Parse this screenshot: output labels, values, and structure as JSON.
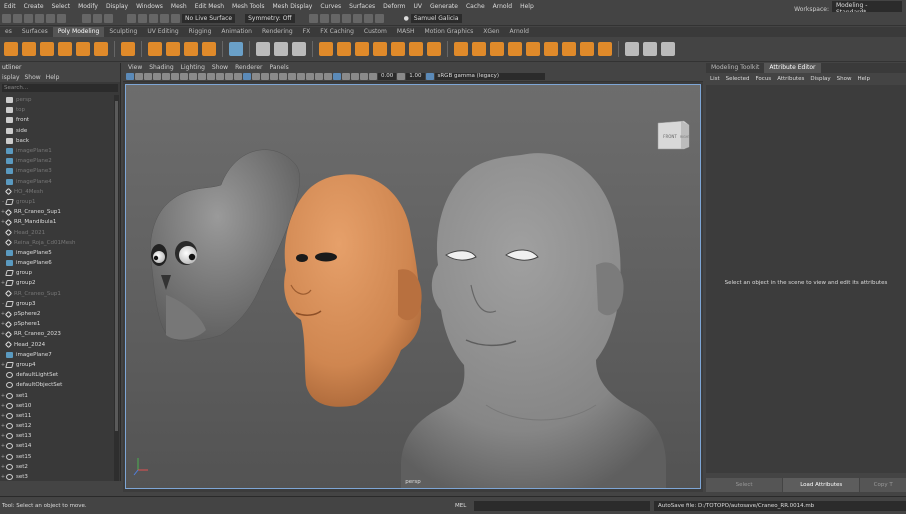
{
  "menubar": {
    "items": [
      "Edit",
      "Create",
      "Select",
      "Modify",
      "Display",
      "Windows",
      "Mesh",
      "Edit Mesh",
      "Mesh Tools",
      "Mesh Display",
      "Curves",
      "Surfaces",
      "Deform",
      "UV",
      "Generate",
      "Cache",
      "Arnold",
      "Help"
    ],
    "workspace_label": "Workspace:",
    "workspace_value": "Modeling - Standard*"
  },
  "statusline": {
    "live_surface": "No Live Surface",
    "symmetry": "Symmetry: Off",
    "user": "Samuel Galicia"
  },
  "shelf": {
    "tabs": [
      "es",
      "Surfaces",
      "Poly Modeling",
      "Sculpting",
      "UV Editing",
      "Rigging",
      "Animation",
      "Rendering",
      "FX",
      "FX Caching",
      "Custom",
      "MASH",
      "Motion Graphics",
      "XGen",
      "Arnold"
    ],
    "active_tab": "Poly Modeling"
  },
  "outliner": {
    "title": "utliner",
    "menu": [
      "isplay",
      "Show",
      "Help"
    ],
    "search_placeholder": "Search...",
    "items": [
      {
        "label": "persp",
        "icon": "cam",
        "dim": true,
        "exp": ""
      },
      {
        "label": "top",
        "icon": "cam",
        "dim": true,
        "exp": ""
      },
      {
        "label": "front",
        "icon": "cam",
        "dim": false,
        "exp": ""
      },
      {
        "label": "side",
        "icon": "cam",
        "dim": false,
        "exp": ""
      },
      {
        "label": "back",
        "icon": "cam",
        "dim": false,
        "exp": ""
      },
      {
        "label": "imagePlane1",
        "icon": "img",
        "dim": true,
        "exp": ""
      },
      {
        "label": "imagePlane2",
        "icon": "img",
        "dim": true,
        "exp": ""
      },
      {
        "label": "imagePlane3",
        "icon": "img",
        "dim": true,
        "exp": ""
      },
      {
        "label": "imagePlane4",
        "icon": "img",
        "dim": true,
        "exp": ""
      },
      {
        "label": "HO_4Mesh",
        "icon": "mesh",
        "dim": true,
        "exp": ""
      },
      {
        "label": "group1",
        "icon": "grp",
        "dim": true,
        "exp": "-"
      },
      {
        "label": "RR_Craneo_Sup1",
        "icon": "mesh",
        "dim": false,
        "exp": "+"
      },
      {
        "label": "RR_Mandibula1",
        "icon": "mesh",
        "dim": false,
        "exp": "+"
      },
      {
        "label": "Head_2021",
        "icon": "mesh",
        "dim": true,
        "exp": ""
      },
      {
        "label": "Reina_Roja_Cd01Mesh",
        "icon": "mesh",
        "dim": true,
        "exp": ""
      },
      {
        "label": "imagePlane5",
        "icon": "img",
        "dim": false,
        "exp": ""
      },
      {
        "label": "imagePlane6",
        "icon": "img",
        "dim": false,
        "exp": ""
      },
      {
        "label": "group",
        "icon": "grp",
        "dim": false,
        "exp": ""
      },
      {
        "label": "group2",
        "icon": "grp",
        "dim": false,
        "exp": "+"
      },
      {
        "label": "RR_Craneo_Sup1",
        "icon": "mesh",
        "dim": true,
        "exp": ""
      },
      {
        "label": "group3",
        "icon": "grp",
        "dim": false,
        "exp": "-"
      },
      {
        "label": "pSphere2",
        "icon": "mesh",
        "dim": false,
        "exp": "+"
      },
      {
        "label": "pSphere1",
        "icon": "mesh",
        "dim": false,
        "exp": "+"
      },
      {
        "label": "RR_Craneo_2023",
        "icon": "mesh",
        "dim": false,
        "exp": "+"
      },
      {
        "label": "Head_2024",
        "icon": "mesh",
        "dim": false,
        "exp": ""
      },
      {
        "label": "imagePlane7",
        "icon": "img",
        "dim": false,
        "exp": ""
      },
      {
        "label": "group4",
        "icon": "grp",
        "dim": false,
        "exp": "+"
      },
      {
        "label": "defaultLightSet",
        "icon": "set",
        "dim": false,
        "exp": ""
      },
      {
        "label": "defaultObjectSet",
        "icon": "set",
        "dim": false,
        "exp": ""
      },
      {
        "label": "set1",
        "icon": "set",
        "dim": false,
        "exp": "+"
      },
      {
        "label": "set10",
        "icon": "set",
        "dim": false,
        "exp": "+"
      },
      {
        "label": "set11",
        "icon": "set",
        "dim": false,
        "exp": "+"
      },
      {
        "label": "set12",
        "icon": "set",
        "dim": false,
        "exp": "+"
      },
      {
        "label": "set13",
        "icon": "set",
        "dim": false,
        "exp": "+"
      },
      {
        "label": "set14",
        "icon": "set",
        "dim": false,
        "exp": "+"
      },
      {
        "label": "set15",
        "icon": "set",
        "dim": false,
        "exp": "+"
      },
      {
        "label": "set2",
        "icon": "set",
        "dim": false,
        "exp": "+"
      },
      {
        "label": "set3",
        "icon": "set",
        "dim": false,
        "exp": "+"
      }
    ]
  },
  "viewport": {
    "menu": [
      "View",
      "Shading",
      "Lighting",
      "Show",
      "Renderer",
      "Panels"
    ],
    "exposure": "0.00",
    "gamma": "1.00",
    "color_space": "sRGB gamma (legacy)",
    "camera_label": "persp",
    "viewcube_front": "FRONT",
    "viewcube_right": "RIGHT"
  },
  "attribute_editor": {
    "tabs": [
      "Modeling Toolkit",
      "Attribute Editor"
    ],
    "active_tab": "Attribute Editor",
    "menu": [
      "List",
      "Selected",
      "Focus",
      "Attributes",
      "Display",
      "Show",
      "Help"
    ],
    "message": "Select an object in the scene to view and edit its attributes",
    "buttons": [
      "Select",
      "Load Attributes",
      "Copy T"
    ]
  },
  "statusbar": {
    "help_line": "Tool: Select an object to move.",
    "mel_label": "MEL",
    "result": "AutoSave file: D:/TOTOPO/autosave/Craneo_RR.0014.mb"
  },
  "colors": {
    "skin": "#d98f55",
    "grey_model": "#8a8a8a",
    "accent": "#e08a2a",
    "selection_border": "#7ea6d6"
  }
}
